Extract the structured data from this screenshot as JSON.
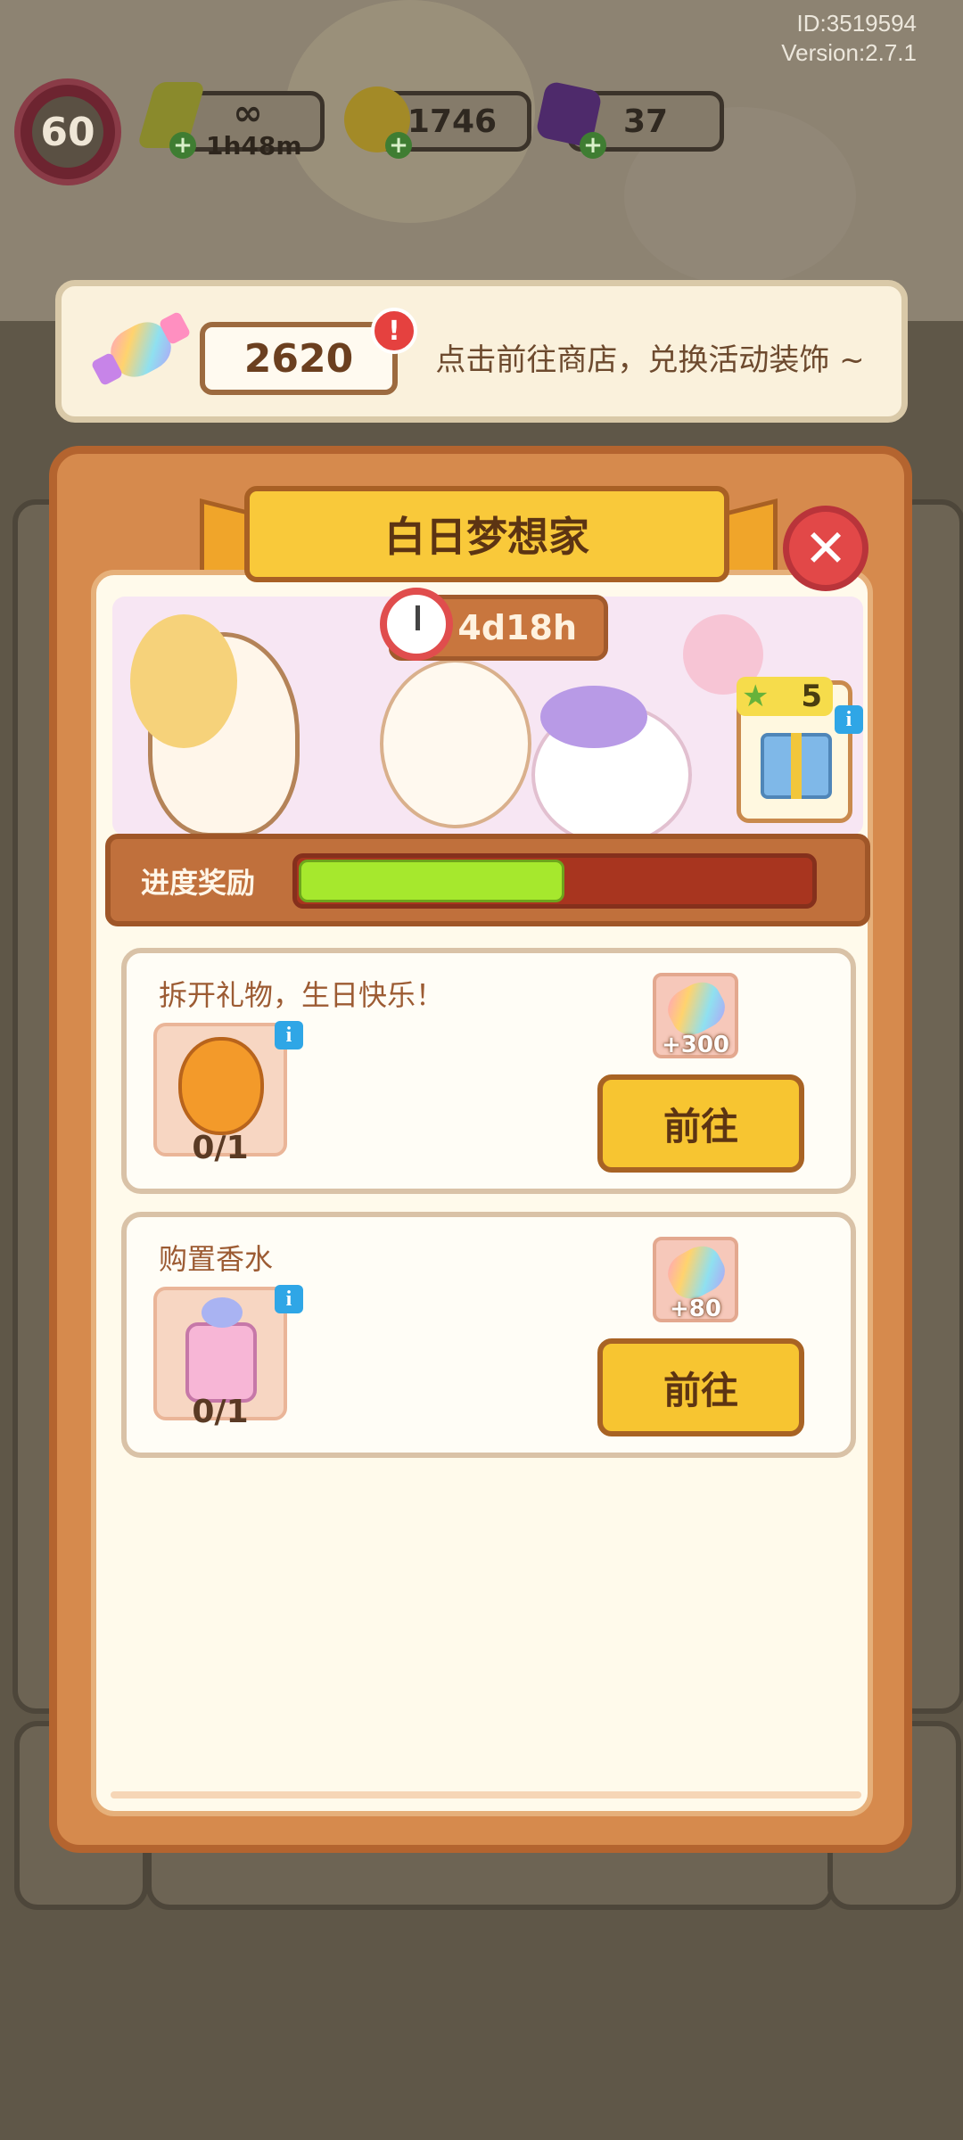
{
  "meta": {
    "id": "ID:3519594",
    "version": "Version:2.7.1"
  },
  "hud": {
    "level": "60",
    "energy": "∞",
    "energy_timer": "1h48m",
    "coins": "1746",
    "gems": "37"
  },
  "banner": {
    "candy_count": "2620",
    "alert": "!",
    "text": "点击前往商店，兑换活动装饰 ~"
  },
  "panel": {
    "title": "白日梦想家",
    "close": "✕",
    "timer": "4d18h",
    "reward_stars": "5",
    "progress_label": "进度奖励",
    "progress_fraction": 0.52
  },
  "tasks": [
    {
      "title": "拆开礼物，生日快乐！",
      "progress": "0/1",
      "reward": "+300",
      "button": "前往"
    },
    {
      "title": "购置香水",
      "progress": "0/1",
      "reward": "+80",
      "button": "前往"
    }
  ],
  "colors": {
    "accent": "#f7c531",
    "progress": "#a6e82d",
    "panel": "#d68a4d",
    "close": "#e24848"
  }
}
